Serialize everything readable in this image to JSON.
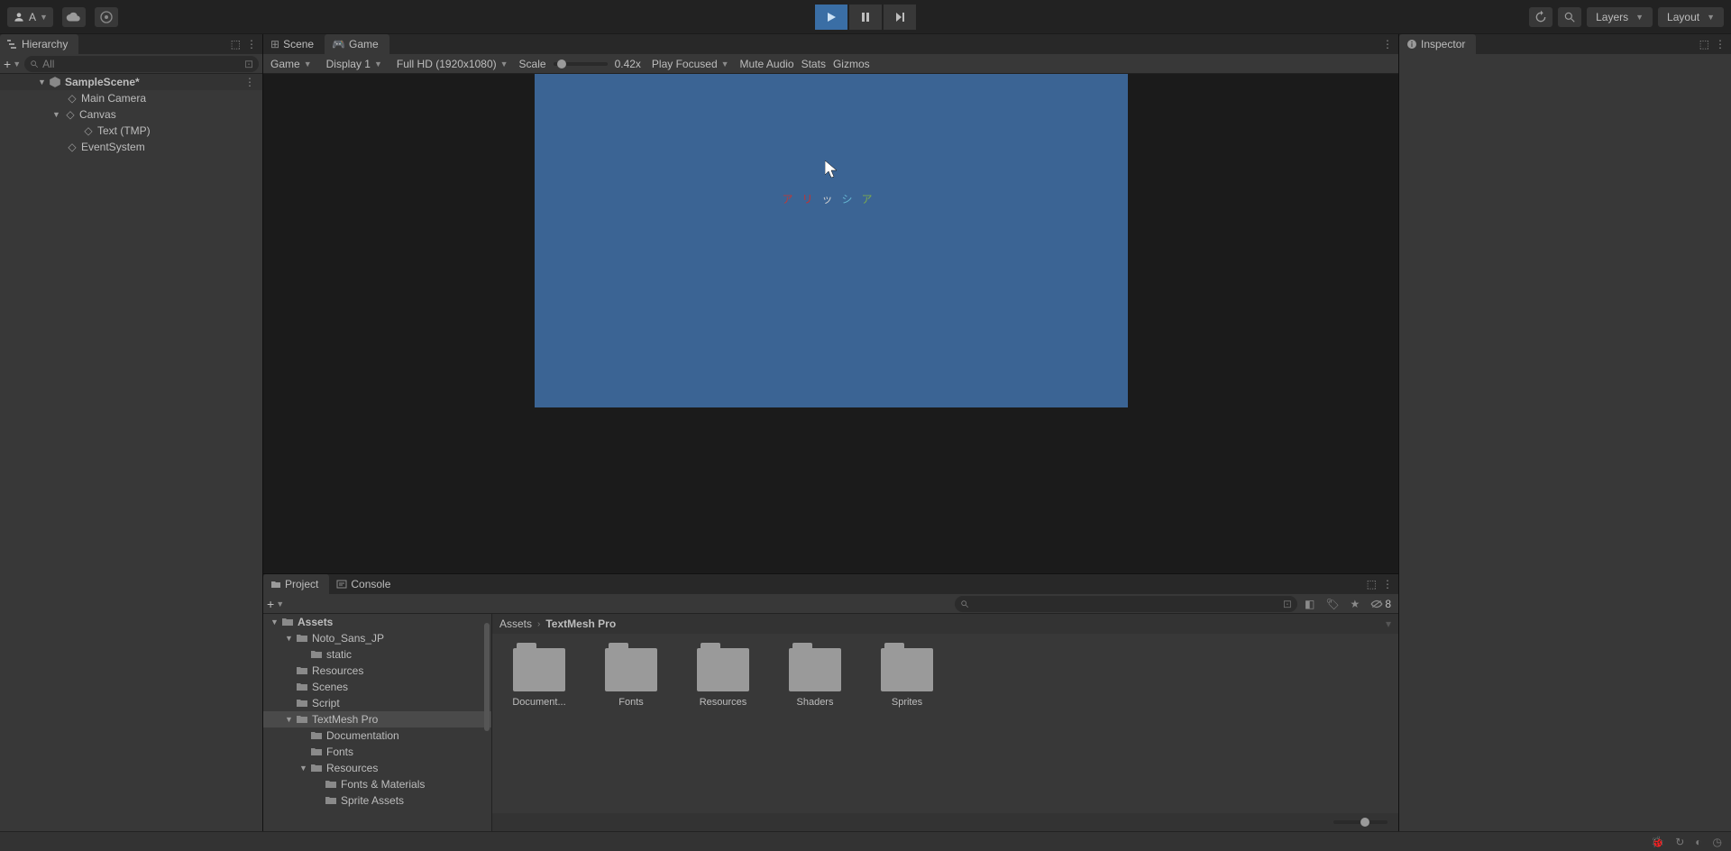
{
  "topbar": {
    "account_label": "A",
    "layers_label": "Layers",
    "layout_label": "Layout"
  },
  "hierarchy": {
    "tab_label": "Hierarchy",
    "search_placeholder": "All",
    "scene_name": "SampleScene*",
    "items": [
      {
        "label": "Main Camera",
        "indent": 2
      },
      {
        "label": "Canvas",
        "indent": 2,
        "expanded": true
      },
      {
        "label": "Text (TMP)",
        "indent": 3
      },
      {
        "label": "EventSystem",
        "indent": 2
      }
    ]
  },
  "scene": {
    "scene_tab": "Scene",
    "game_tab": "Game",
    "game_label": "Game",
    "display_label": "Display 1",
    "resolution_label": "Full HD (1920x1080)",
    "scale_label": "Scale",
    "scale_value": "0.42x",
    "play_mode_label": "Play Focused",
    "mute_label": "Mute Audio",
    "stats_label": "Stats",
    "gizmos_label": "Gizmos",
    "game_text": "アリッシア"
  },
  "project": {
    "project_tab": "Project",
    "console_tab": "Console",
    "hidden_count": "8",
    "breadcrumb": [
      "Assets",
      "TextMesh Pro"
    ],
    "tree": [
      {
        "label": "Assets",
        "indent": 0,
        "expanded": true,
        "bold": true
      },
      {
        "label": "Noto_Sans_JP",
        "indent": 1,
        "expanded": true
      },
      {
        "label": "static",
        "indent": 2
      },
      {
        "label": "Resources",
        "indent": 1
      },
      {
        "label": "Scenes",
        "indent": 1
      },
      {
        "label": "Script",
        "indent": 1
      },
      {
        "label": "TextMesh Pro",
        "indent": 1,
        "expanded": true,
        "selected": true
      },
      {
        "label": "Documentation",
        "indent": 2
      },
      {
        "label": "Fonts",
        "indent": 2
      },
      {
        "label": "Resources",
        "indent": 2,
        "expanded": true
      },
      {
        "label": "Fonts & Materials",
        "indent": 3
      },
      {
        "label": "Sprite Assets",
        "indent": 3
      }
    ],
    "folders": [
      {
        "label": "Document..."
      },
      {
        "label": "Fonts"
      },
      {
        "label": "Resources"
      },
      {
        "label": "Shaders"
      },
      {
        "label": "Sprites"
      }
    ]
  },
  "inspector": {
    "tab_label": "Inspector"
  }
}
